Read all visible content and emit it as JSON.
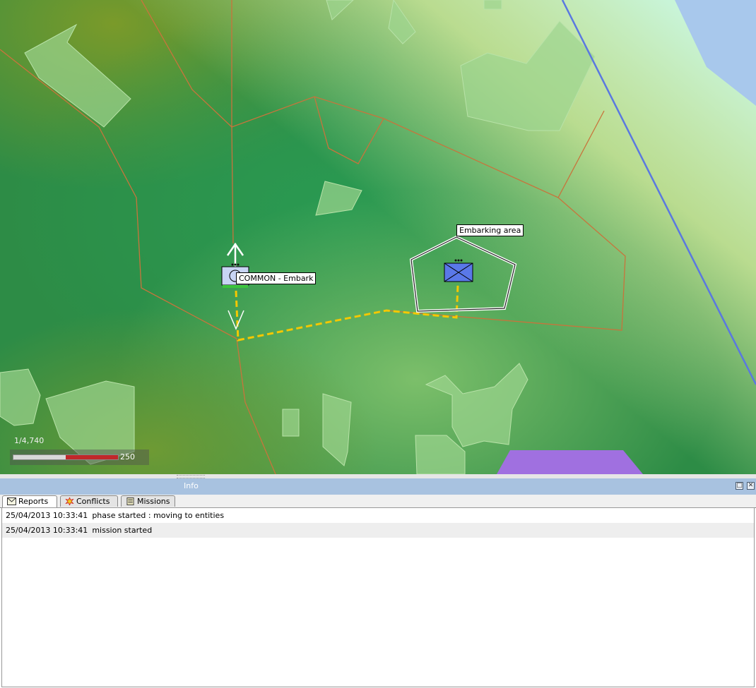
{
  "map": {
    "unit_label": "COMMON - Embark",
    "area_label": "Embarking area",
    "scale": {
      "ratio_text": "1/4,740",
      "max_text": "250",
      "fill_fraction": 0.5
    },
    "colors": {
      "route": "#f5c800",
      "boundary": "#c8743c",
      "river": "#5a78e0",
      "water": "#a8c8ec",
      "restricted": "#a070e0"
    }
  },
  "info_panel": {
    "title": "Info",
    "tabs": [
      {
        "label": "Reports",
        "icon": "envelope-icon",
        "active": true
      },
      {
        "label": "Conflicts",
        "icon": "explosion-icon",
        "active": false
      },
      {
        "label": "Missions",
        "icon": "list-icon",
        "active": false
      }
    ],
    "reports": [
      {
        "timestamp": "25/04/2013 10:33:41",
        "message": "phase started : moving to entities"
      },
      {
        "timestamp": "25/04/2013 10:33:41",
        "message": "mission started"
      }
    ]
  }
}
